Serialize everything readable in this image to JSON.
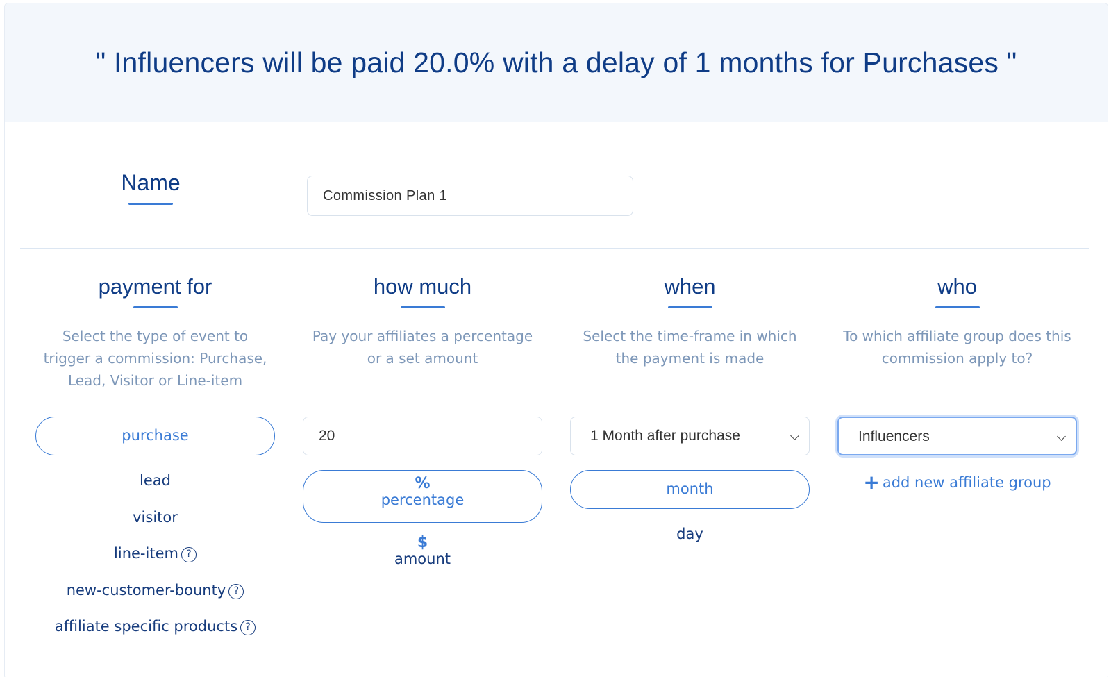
{
  "banner": {
    "text": "\" Influencers will be paid 20.0% with a delay of 1 months for Purchases \""
  },
  "name": {
    "label": "Name",
    "value": "Commission Plan 1"
  },
  "columns": {
    "payment_for": {
      "title": "payment for",
      "description": "Select the type of event to trigger a commission: Purchase, Lead, Visitor or Line-item",
      "selected": "purchase",
      "options": [
        "lead",
        "visitor",
        "line-item",
        "new-customer-bounty",
        "affiliate specific products"
      ],
      "help_glyph": "?"
    },
    "how_much": {
      "title": "how much",
      "description": "Pay your affiliates a percentage or a set amount",
      "value": "20",
      "selected_symbol": "%",
      "selected": "percentage",
      "alt_symbol": "$",
      "alt": "amount"
    },
    "when": {
      "title": "when",
      "description": "Select the time-frame in which the payment is made",
      "select_value": "1 Month after purchase",
      "selected": "month",
      "alt": "day"
    },
    "who": {
      "title": "who",
      "description": "To which affiliate group does this commission apply to?",
      "select_value": "Influencers",
      "add_link_plus": "+",
      "add_link": "add new affiliate group"
    }
  },
  "colors": {
    "primary": "#3a7bd5",
    "heading": "#0f3c86",
    "muted": "#7d97b8",
    "banner_bg": "#f3f7fc"
  },
  "icons": {
    "help": "question-circle-icon",
    "chevron": "chevron-down-icon",
    "add": "plus-icon"
  }
}
